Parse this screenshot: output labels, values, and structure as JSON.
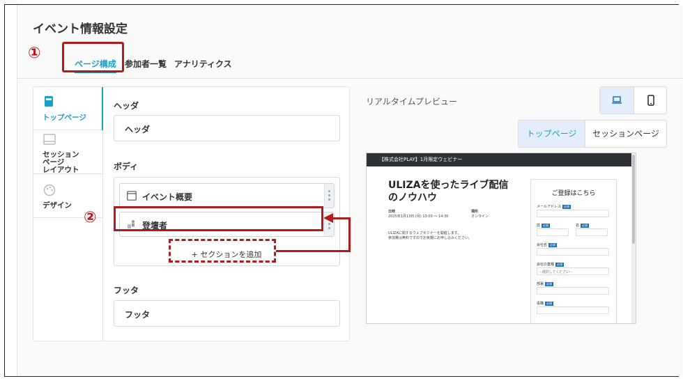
{
  "page_title": "イベント情報設定",
  "tabs": [
    {
      "label": "ページ構成",
      "active": true
    },
    {
      "label": "参加者一覧",
      "active": false
    },
    {
      "label": "アナリティクス",
      "active": false
    }
  ],
  "sidebar": {
    "items": [
      {
        "label": "トップページ",
        "icon": "page-icon",
        "active": true
      },
      {
        "label": "セッション\nページ\nレイアウト",
        "icon": "layout-icon",
        "active": false
      },
      {
        "label": "デザイン",
        "icon": "palette-icon",
        "active": false
      }
    ]
  },
  "sections": {
    "header_label": "ヘッダ",
    "header_box": "ヘッダ",
    "body_label": "ボディ",
    "body_items": [
      {
        "label": "イベント概要",
        "icon": "window-icon"
      },
      {
        "label": "登壇者",
        "icon": "speaker-icon"
      }
    ],
    "add_section": "+ セクションを追加",
    "footer_label": "フッタ",
    "footer_box": "フッタ"
  },
  "preview": {
    "label": "リアルタイムプレビュー",
    "device_toggle": {
      "pc_icon": "laptop-icon",
      "sp_icon": "smartphone-icon"
    },
    "page_toggle": [
      "トップページ",
      "セッションページ"
    ],
    "header_text": "【株式会社PLAY】1月限定ウェビナー",
    "event_title": "ULIZAを使ったライブ配信のノウハウ",
    "date_label": "日時",
    "date_value": "2025年1月13日 (月) 13:00 ～ 14:30",
    "place_label": "場所",
    "place_value": "オンライン",
    "description_line1": "ULIZAに関するウェブセミナーを開催します。",
    "description_line2": "参加費は無料ですのでお気軽にお申し込みください。",
    "form": {
      "title": "ご登録はこちら",
      "required_badge": "必須",
      "fields": {
        "mail": "メールアドレス",
        "last": "姓",
        "first": "名",
        "company": "会社名",
        "industry": "会社の業種",
        "industry_placeholder": "--選択してください--",
        "department": "部署",
        "position": "役職"
      }
    }
  },
  "annotations": {
    "marker1": "①",
    "marker2": "②",
    "accent_color": "#b01c1c"
  }
}
